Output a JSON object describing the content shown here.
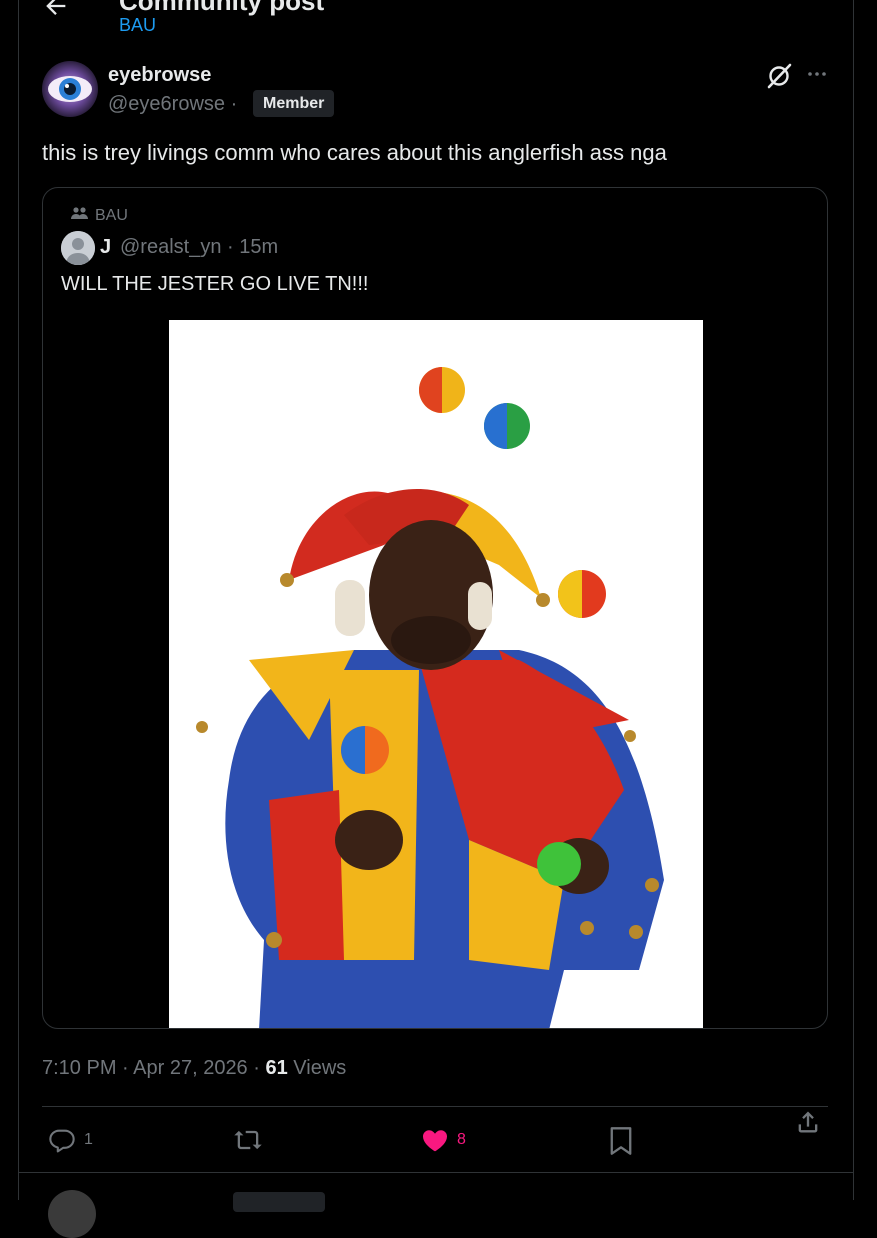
{
  "header": {
    "title": "Community post",
    "community": "BAU"
  },
  "post": {
    "author_name": "eyebrowse",
    "author_handle": "@eye6rowse ·",
    "badge": "Member",
    "text": "this is trey livings comm who cares about this anglerfish ass nga",
    "timestamp": "7:10 PM · Apr 27, 2026 · ",
    "views_count": "61",
    "views_label": " Views"
  },
  "quote": {
    "community": "BAU",
    "author_name": "J",
    "author_handle": "@realst_yn · 15m",
    "text": "WILL THE JESTER GO LIVE TN!!!"
  },
  "actions": {
    "reply_count": "1",
    "like_count": "8"
  },
  "colors": {
    "accent": "#1d9bf0",
    "like": "#f91880",
    "muted": "#71767b",
    "border": "#2f3336"
  },
  "icons": [
    "back-arrow-icon",
    "grok-icon",
    "more-icon",
    "community-icon",
    "reply-icon",
    "repost-icon",
    "like-icon",
    "bookmark-icon",
    "share-icon"
  ]
}
